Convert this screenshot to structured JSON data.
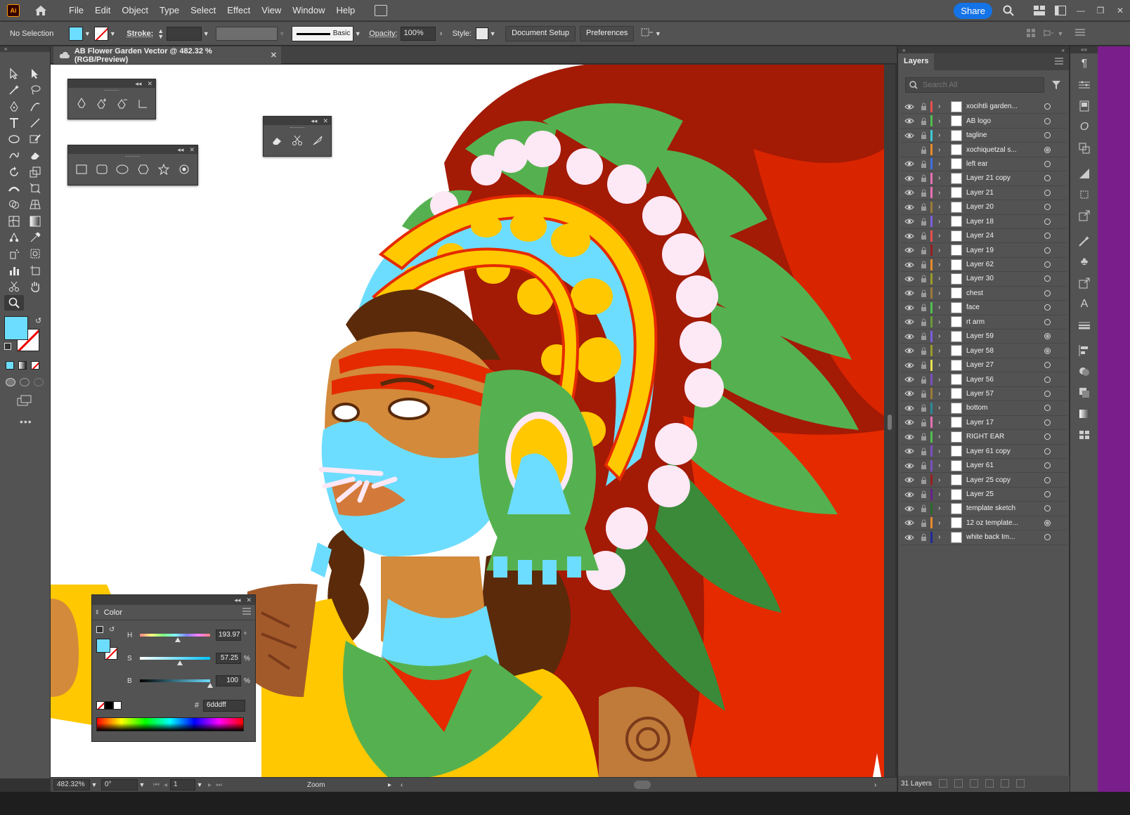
{
  "app": {
    "logo_text": "Ai"
  },
  "menubar": {
    "items": [
      "File",
      "Edit",
      "Object",
      "Type",
      "Select",
      "Effect",
      "View",
      "Window",
      "Help"
    ],
    "share_label": "Share"
  },
  "controlbar": {
    "selection_label": "No Selection",
    "stroke_label": "Stroke:",
    "stroke_style": "Basic",
    "opacity_label": "Opacity:",
    "opacity_value": "100%",
    "style_label": "Style:",
    "document_setup": "Document Setup",
    "preferences": "Preferences",
    "fill_color": "#6dddff"
  },
  "document": {
    "tab_title": "AB Flower Garden Vector @ 482.32 % (RGB/Preview)"
  },
  "statusbar": {
    "zoom": "482.32%",
    "rotation": "0°",
    "artboard": "1",
    "tool_name": "Zoom"
  },
  "color_panel": {
    "title": "Color",
    "h_label": "H",
    "h_value": "193.97",
    "h_unit": "°",
    "h_fraction": 0.54,
    "s_label": "S",
    "s_value": "57.25",
    "s_unit": "%",
    "s_fraction": 0.57,
    "b_label": "B",
    "b_value": "100",
    "b_unit": "%",
    "b_fraction": 1.0,
    "hex_label": "#",
    "hex_value": "6dddff",
    "fill_color": "#6dddff"
  },
  "layers_panel": {
    "title": "Layers",
    "search_placeholder": "Search All",
    "count_label": "31 Layers",
    "layers": [
      {
        "name": "xocihtli garden...",
        "color": "#e84f4f",
        "visible": true,
        "target_filled": false
      },
      {
        "name": "AB logo",
        "color": "#4fbf4f",
        "visible": true,
        "target_filled": false
      },
      {
        "name": "tagline",
        "color": "#3fc9d6",
        "visible": true,
        "target_filled": false
      },
      {
        "name": "xochiquetzal s...",
        "color": "#e88a2a",
        "visible": false,
        "target_filled": true
      },
      {
        "name": "left ear",
        "color": "#3f6fe0",
        "visible": true,
        "target_filled": false
      },
      {
        "name": "Layer 21 copy",
        "color": "#e86fb5",
        "visible": true,
        "target_filled": false
      },
      {
        "name": "Layer 21",
        "color": "#e86fb5",
        "visible": true,
        "target_filled": false
      },
      {
        "name": "Layer 20",
        "color": "#9b7a3a",
        "visible": true,
        "target_filled": false
      },
      {
        "name": "Layer 18",
        "color": "#7b5fe0",
        "visible": true,
        "target_filled": false
      },
      {
        "name": "Layer 24",
        "color": "#e84f4f",
        "visible": true,
        "target_filled": false
      },
      {
        "name": "Layer 19",
        "color": "#9a1f1f",
        "visible": true,
        "target_filled": false
      },
      {
        "name": "Layer 62",
        "color": "#e88a2a",
        "visible": true,
        "target_filled": false
      },
      {
        "name": "Layer 30",
        "color": "#9b9b2a",
        "visible": true,
        "target_filled": false
      },
      {
        "name": "chest",
        "color": "#9b7a3a",
        "visible": true,
        "target_filled": false
      },
      {
        "name": "face",
        "color": "#4fbf4f",
        "visible": true,
        "target_filled": false
      },
      {
        "name": "rt arm",
        "color": "#6a9a3a",
        "visible": true,
        "target_filled": false
      },
      {
        "name": "Layer 59",
        "color": "#7b5fe0",
        "visible": true,
        "target_filled": true
      },
      {
        "name": "Layer 58",
        "color": "#9b9b2a",
        "visible": true,
        "target_filled": true
      },
      {
        "name": "Layer 27",
        "color": "#e8e04f",
        "visible": true,
        "target_filled": false
      },
      {
        "name": "Layer 56",
        "color": "#7a4fbf",
        "visible": true,
        "target_filled": false
      },
      {
        "name": "Layer 57",
        "color": "#9b7a3a",
        "visible": true,
        "target_filled": false
      },
      {
        "name": "bottom",
        "color": "#2a8a9a",
        "visible": true,
        "target_filled": false
      },
      {
        "name": "Layer 17",
        "color": "#e86fb5",
        "visible": true,
        "target_filled": false
      },
      {
        "name": "RIGHT EAR",
        "color": "#4fbf4f",
        "visible": true,
        "target_filled": false
      },
      {
        "name": "Layer 61 copy",
        "color": "#7a4fbf",
        "visible": true,
        "target_filled": false
      },
      {
        "name": "Layer 61",
        "color": "#7a4fbf",
        "visible": true,
        "target_filled": false
      },
      {
        "name": "Layer 25 copy",
        "color": "#9a1f1f",
        "visible": true,
        "target_filled": false
      },
      {
        "name": "Layer 25",
        "color": "#6a1f8a",
        "visible": true,
        "target_filled": false
      },
      {
        "name": "template sketch",
        "color": "#2a6a2a",
        "visible": true,
        "target_filled": false
      },
      {
        "name": "12 oz template...",
        "color": "#e88a2a",
        "visible": true,
        "target_filled": true
      },
      {
        "name": "white back Im...",
        "color": "#1f2a9a",
        "visible": true,
        "target_filled": false
      }
    ]
  },
  "colors": {
    "artwork_red_dark": "#a31a05",
    "artwork_red": "#e52a00",
    "artwork_green": "#55b14f",
    "artwork_green_dark": "#3a8a3a",
    "artwork_cyan": "#6dddff",
    "artwork_yellow": "#ffc800",
    "artwork_skin": "#d38a3a",
    "artwork_brown": "#5a2a0a",
    "artwork_pink": "#fde8f5"
  }
}
